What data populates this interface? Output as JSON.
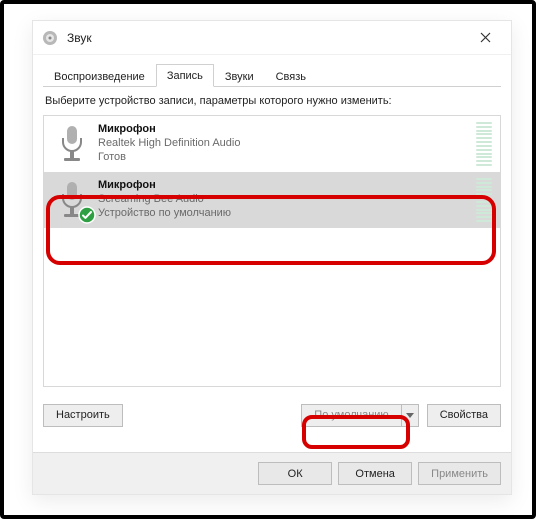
{
  "window": {
    "title": "Звук"
  },
  "tabs": {
    "playback": "Воспроизведение",
    "recording": "Запись",
    "sounds": "Звуки",
    "comm": "Связь"
  },
  "instruction": "Выберите устройство записи, параметры которого нужно изменить:",
  "devices": [
    {
      "name": "Микрофон",
      "sub": "Realtek High Definition Audio",
      "status": "Готов",
      "default": false
    },
    {
      "name": "Микрофон",
      "sub": "Screaming Bee Audio",
      "status": "Устройство по умолчанию",
      "default": true
    }
  ],
  "buttons": {
    "configure": "Настроить",
    "set_default": "По умолчанию",
    "properties": "Свойства",
    "ok": "ОК",
    "cancel": "Отмена",
    "apply": "Применить"
  }
}
